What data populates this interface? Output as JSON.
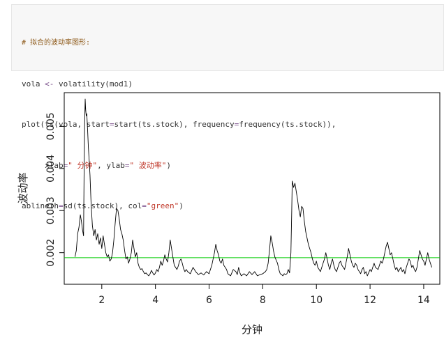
{
  "code": {
    "comment": "# 拟合的波动率图形:",
    "line1_parts": [
      "vola ",
      "<-",
      " volatility(mod1)"
    ],
    "line2_parts": [
      "plot(ts(vola, start",
      "=",
      "start(ts.stock), frequency",
      "=",
      "frequency(ts.stock)),"
    ],
    "line3_parts": [
      "     xlab",
      "=",
      "\" 分钟\"",
      ", ylab",
      "=",
      "\" 波动率\"",
      ")"
    ],
    "line4_parts": [
      "abline(h",
      "=",
      "sd(ts.stock), col",
      "=",
      "\"green\"",
      ")"
    ]
  },
  "colors": {
    "series": "#000000",
    "abline": "#00cc00",
    "comment": "#8e5a1a",
    "string": "#c0392b",
    "code_bg": "#f7f7f7"
  },
  "chart_data": {
    "type": "line",
    "xlabel": "分钟",
    "ylabel": "波动率",
    "xlim": [
      0.6,
      14.6
    ],
    "ylim": [
      0.00125,
      0.0058
    ],
    "xticks": [
      2,
      4,
      6,
      8,
      10,
      12,
      14
    ],
    "xtick_labels": [
      "2",
      "4",
      "6",
      "8",
      "10",
      "12",
      "14"
    ],
    "yticks": [
      0.002,
      0.003,
      0.004,
      0.005
    ],
    "ytick_labels": [
      "0.002",
      "0.003",
      "0.004",
      "0.005"
    ],
    "hline": {
      "y": 0.00188,
      "color": "green"
    },
    "series": [
      {
        "color": "black",
        "points": [
          [
            1.0,
            0.0019
          ],
          [
            1.05,
            0.00205
          ],
          [
            1.1,
            0.00245
          ],
          [
            1.15,
            0.0026
          ],
          [
            1.2,
            0.0029
          ],
          [
            1.24,
            0.00275
          ],
          [
            1.28,
            0.00255
          ],
          [
            1.32,
            0.0024
          ],
          [
            1.34,
            0.0038
          ],
          [
            1.36,
            0.005
          ],
          [
            1.38,
            0.00565
          ],
          [
            1.4,
            0.0054
          ],
          [
            1.42,
            0.00525
          ],
          [
            1.44,
            0.0053
          ],
          [
            1.47,
            0.00495
          ],
          [
            1.5,
            0.0045
          ],
          [
            1.53,
            0.0042
          ],
          [
            1.56,
            0.00385
          ],
          [
            1.6,
            0.0032
          ],
          [
            1.65,
            0.00265
          ],
          [
            1.7,
            0.0024
          ],
          [
            1.75,
            0.00255
          ],
          [
            1.8,
            0.0023
          ],
          [
            1.85,
            0.00245
          ],
          [
            1.9,
            0.0022
          ],
          [
            1.95,
            0.00235
          ],
          [
            2.0,
            0.0021
          ],
          [
            2.05,
            0.0024
          ],
          [
            2.1,
            0.0022
          ],
          [
            2.15,
            0.002
          ],
          [
            2.2,
            0.0019
          ],
          [
            2.25,
            0.00195
          ],
          [
            2.3,
            0.0018
          ],
          [
            2.35,
            0.00185
          ],
          [
            2.4,
            0.002
          ],
          [
            2.45,
            0.0023
          ],
          [
            2.5,
            0.0027
          ],
          [
            2.55,
            0.00305
          ],
          [
            2.6,
            0.003
          ],
          [
            2.65,
            0.0028
          ],
          [
            2.7,
            0.00255
          ],
          [
            2.75,
            0.00245
          ],
          [
            2.8,
            0.0023
          ],
          [
            2.85,
            0.00205
          ],
          [
            2.9,
            0.00185
          ],
          [
            2.95,
            0.0019
          ],
          [
            3.0,
            0.00175
          ],
          [
            3.05,
            0.00185
          ],
          [
            3.1,
            0.002
          ],
          [
            3.15,
            0.0023
          ],
          [
            3.2,
            0.0021
          ],
          [
            3.25,
            0.0019
          ],
          [
            3.3,
            0.002
          ],
          [
            3.35,
            0.00175
          ],
          [
            3.4,
            0.00165
          ],
          [
            3.45,
            0.0016
          ],
          [
            3.5,
            0.00162
          ],
          [
            3.55,
            0.00155
          ],
          [
            3.6,
            0.0015
          ],
          [
            3.65,
            0.00152
          ],
          [
            3.7,
            0.00148
          ],
          [
            3.75,
            0.00145
          ],
          [
            3.8,
            0.0015
          ],
          [
            3.85,
            0.00158
          ],
          [
            3.9,
            0.00152
          ],
          [
            3.95,
            0.00147
          ],
          [
            4.0,
            0.00152
          ],
          [
            4.05,
            0.0016
          ],
          [
            4.1,
            0.00155
          ],
          [
            4.15,
            0.00165
          ],
          [
            4.2,
            0.0018
          ],
          [
            4.25,
            0.0017
          ],
          [
            4.3,
            0.0018
          ],
          [
            4.35,
            0.00195
          ],
          [
            4.4,
            0.00185
          ],
          [
            4.45,
            0.00178
          ],
          [
            4.5,
            0.002
          ],
          [
            4.55,
            0.0023
          ],
          [
            4.6,
            0.0021
          ],
          [
            4.65,
            0.0019
          ],
          [
            4.7,
            0.0017
          ],
          [
            4.75,
            0.00165
          ],
          [
            4.8,
            0.0016
          ],
          [
            4.85,
            0.00168
          ],
          [
            4.9,
            0.0018
          ],
          [
            4.95,
            0.00185
          ],
          [
            5.0,
            0.00175
          ],
          [
            5.05,
            0.00162
          ],
          [
            5.1,
            0.00155
          ],
          [
            5.15,
            0.0016
          ],
          [
            5.2,
            0.00155
          ],
          [
            5.3,
            0.0015
          ],
          [
            5.4,
            0.00165
          ],
          [
            5.5,
            0.00155
          ],
          [
            5.6,
            0.00148
          ],
          [
            5.7,
            0.00152
          ],
          [
            5.8,
            0.00147
          ],
          [
            5.9,
            0.00155
          ],
          [
            6.0,
            0.0015
          ],
          [
            6.05,
            0.0016
          ],
          [
            6.1,
            0.0017
          ],
          [
            6.15,
            0.00185
          ],
          [
            6.2,
            0.002
          ],
          [
            6.25,
            0.0022
          ],
          [
            6.3,
            0.00205
          ],
          [
            6.35,
            0.00195
          ],
          [
            6.4,
            0.0018
          ],
          [
            6.45,
            0.00175
          ],
          [
            6.5,
            0.00185
          ],
          [
            6.55,
            0.0017
          ],
          [
            6.6,
            0.00165
          ],
          [
            6.65,
            0.0016
          ],
          [
            6.7,
            0.0015
          ],
          [
            6.8,
            0.00145
          ],
          [
            6.9,
            0.0016
          ],
          [
            7.0,
            0.00155
          ],
          [
            7.05,
            0.00148
          ],
          [
            7.1,
            0.00165
          ],
          [
            7.15,
            0.00152
          ],
          [
            7.2,
            0.00145
          ],
          [
            7.3,
            0.0015
          ],
          [
            7.4,
            0.00145
          ],
          [
            7.5,
            0.00155
          ],
          [
            7.6,
            0.00148
          ],
          [
            7.7,
            0.00155
          ],
          [
            7.8,
            0.00145
          ],
          [
            7.9,
            0.00148
          ],
          [
            8.0,
            0.0015
          ],
          [
            8.1,
            0.00155
          ],
          [
            8.15,
            0.0016
          ],
          [
            8.2,
            0.00175
          ],
          [
            8.25,
            0.00205
          ],
          [
            8.3,
            0.0024
          ],
          [
            8.35,
            0.00225
          ],
          [
            8.4,
            0.00205
          ],
          [
            8.45,
            0.0019
          ],
          [
            8.5,
            0.00182
          ],
          [
            8.55,
            0.00175
          ],
          [
            8.6,
            0.0016
          ],
          [
            8.65,
            0.0015
          ],
          [
            8.7,
            0.00148
          ],
          [
            8.75,
            0.00145
          ],
          [
            8.8,
            0.0015
          ],
          [
            8.85,
            0.00148
          ],
          [
            8.9,
            0.0015
          ],
          [
            8.95,
            0.0016
          ],
          [
            9.0,
            0.00152
          ],
          [
            9.05,
            0.002
          ],
          [
            9.08,
            0.003
          ],
          [
            9.1,
            0.0037
          ],
          [
            9.15,
            0.00355
          ],
          [
            9.2,
            0.00365
          ],
          [
            9.25,
            0.00345
          ],
          [
            9.3,
            0.00325
          ],
          [
            9.35,
            0.003
          ],
          [
            9.4,
            0.00285
          ],
          [
            9.45,
            0.0031
          ],
          [
            9.5,
            0.00305
          ],
          [
            9.55,
            0.00275
          ],
          [
            9.6,
            0.0025
          ],
          [
            9.65,
            0.00235
          ],
          [
            9.7,
            0.0022
          ],
          [
            9.75,
            0.0021
          ],
          [
            9.8,
            0.002
          ],
          [
            9.85,
            0.00185
          ],
          [
            9.9,
            0.00175
          ],
          [
            9.95,
            0.0017
          ],
          [
            10.0,
            0.0018
          ],
          [
            10.05,
            0.00165
          ],
          [
            10.1,
            0.0016
          ],
          [
            10.15,
            0.00155
          ],
          [
            10.2,
            0.00165
          ],
          [
            10.25,
            0.00175
          ],
          [
            10.3,
            0.00185
          ],
          [
            10.35,
            0.002
          ],
          [
            10.4,
            0.00185
          ],
          [
            10.45,
            0.0017
          ],
          [
            10.5,
            0.0016
          ],
          [
            10.55,
            0.00175
          ],
          [
            10.6,
            0.00185
          ],
          [
            10.65,
            0.0017
          ],
          [
            10.7,
            0.0016
          ],
          [
            10.75,
            0.00155
          ],
          [
            10.8,
            0.00165
          ],
          [
            10.85,
            0.00175
          ],
          [
            10.9,
            0.0018
          ],
          [
            10.95,
            0.0017
          ],
          [
            11.0,
            0.00165
          ],
          [
            11.05,
            0.0016
          ],
          [
            11.1,
            0.00175
          ],
          [
            11.15,
            0.0019
          ],
          [
            11.2,
            0.0021
          ],
          [
            11.25,
            0.00195
          ],
          [
            11.3,
            0.0018
          ],
          [
            11.35,
            0.0017
          ],
          [
            11.4,
            0.00165
          ],
          [
            11.45,
            0.00175
          ],
          [
            11.5,
            0.0017
          ],
          [
            11.55,
            0.0016
          ],
          [
            11.6,
            0.00155
          ],
          [
            11.65,
            0.0015
          ],
          [
            11.7,
            0.0016
          ],
          [
            11.75,
            0.00165
          ],
          [
            11.8,
            0.0015
          ],
          [
            11.85,
            0.00155
          ],
          [
            11.9,
            0.00145
          ],
          [
            12.0,
            0.0016
          ],
          [
            12.05,
            0.00155
          ],
          [
            12.1,
            0.00165
          ],
          [
            12.15,
            0.00175
          ],
          [
            12.2,
            0.00165
          ],
          [
            12.3,
            0.0016
          ],
          [
            12.35,
            0.0017
          ],
          [
            12.4,
            0.0018
          ],
          [
            12.45,
            0.00175
          ],
          [
            12.5,
            0.00185
          ],
          [
            12.55,
            0.002
          ],
          [
            12.6,
            0.00215
          ],
          [
            12.65,
            0.00225
          ],
          [
            12.7,
            0.0021
          ],
          [
            12.75,
            0.00195
          ],
          [
            12.8,
            0.002
          ],
          [
            12.85,
            0.00185
          ],
          [
            12.9,
            0.0017
          ],
          [
            12.95,
            0.0016
          ],
          [
            13.0,
            0.00165
          ],
          [
            13.05,
            0.00155
          ],
          [
            13.1,
            0.0016
          ],
          [
            13.15,
            0.00165
          ],
          [
            13.2,
            0.00155
          ],
          [
            13.25,
            0.0016
          ],
          [
            13.3,
            0.0015
          ],
          [
            13.35,
            0.00165
          ],
          [
            13.4,
            0.00175
          ],
          [
            13.45,
            0.00185
          ],
          [
            13.5,
            0.0018
          ],
          [
            13.55,
            0.00165
          ],
          [
            13.6,
            0.0017
          ],
          [
            13.65,
            0.0016
          ],
          [
            13.7,
            0.00155
          ],
          [
            13.75,
            0.00165
          ],
          [
            13.8,
            0.00185
          ],
          [
            13.85,
            0.00205
          ],
          [
            13.9,
            0.00195
          ],
          [
            13.95,
            0.00185
          ],
          [
            14.0,
            0.0018
          ],
          [
            14.05,
            0.0017
          ],
          [
            14.1,
            0.00185
          ],
          [
            14.15,
            0.002
          ],
          [
            14.2,
            0.00185
          ],
          [
            14.25,
            0.00175
          ],
          [
            14.3,
            0.00165
          ]
        ]
      }
    ]
  }
}
